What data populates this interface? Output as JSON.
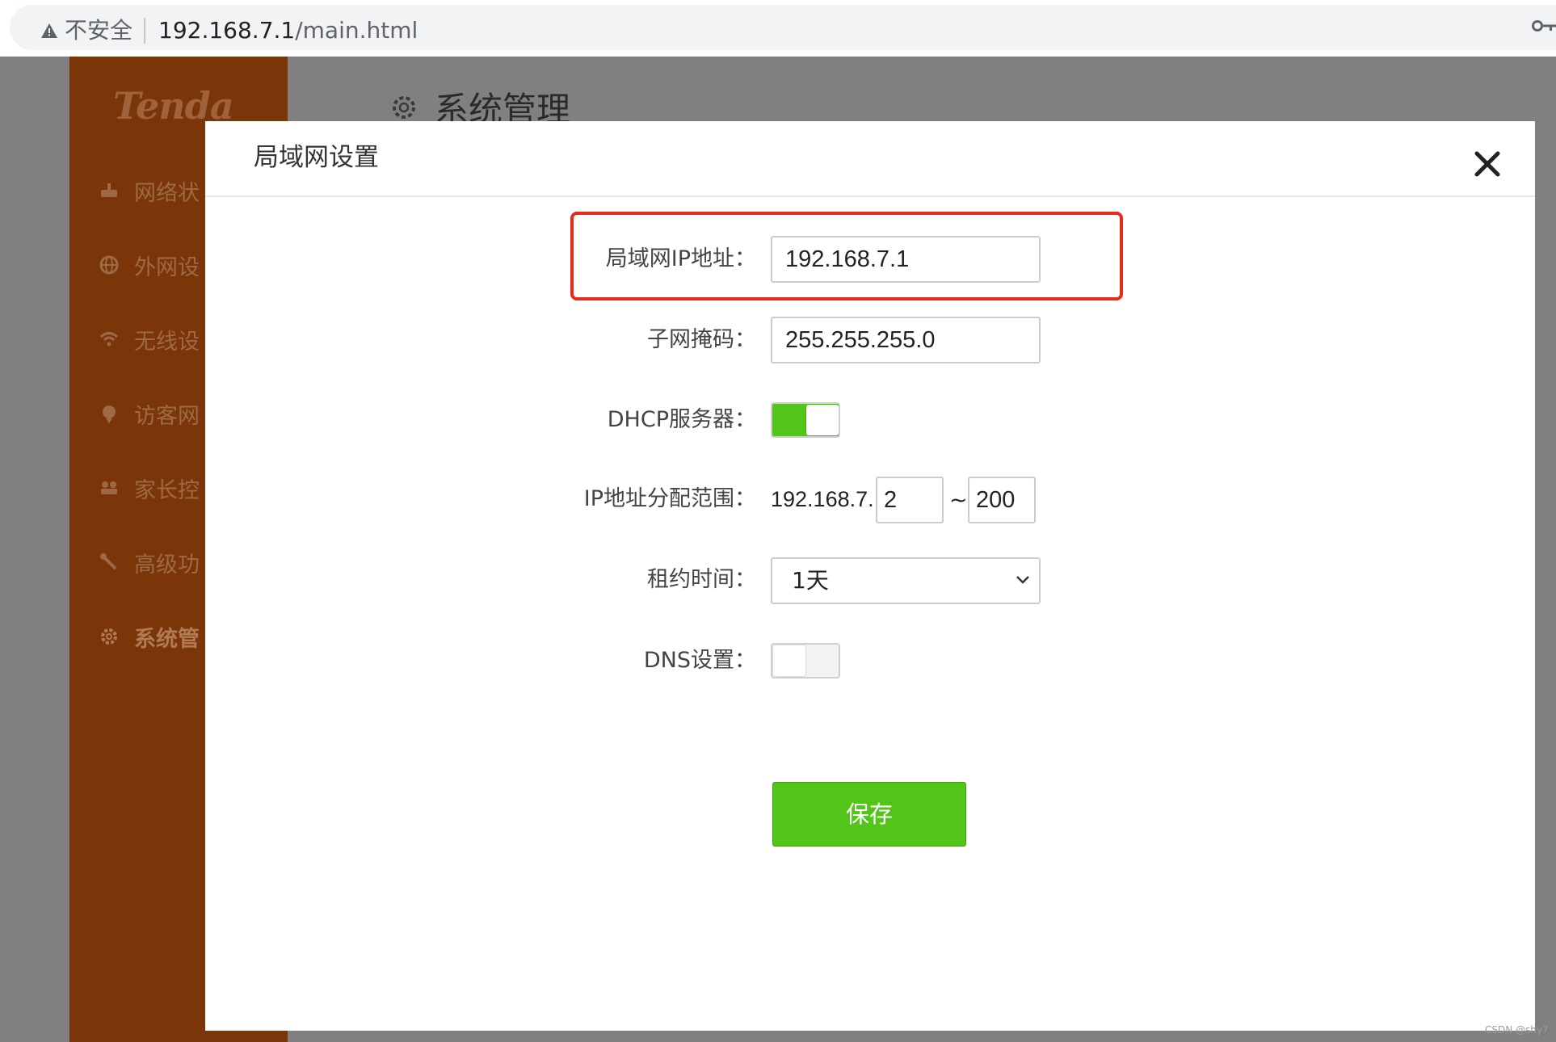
{
  "browser": {
    "security_label": "不安全",
    "url_host": "192.168.7.1",
    "url_path": "/main.html"
  },
  "app": {
    "logo": "Tenda",
    "page_title": "系统管理",
    "sidebar": {
      "items": [
        {
          "label": "网络状",
          "icon": "network-status-icon"
        },
        {
          "label": "外网设",
          "icon": "globe-icon"
        },
        {
          "label": "无线设",
          "icon": "wifi-icon"
        },
        {
          "label": "访客网",
          "icon": "guest-icon"
        },
        {
          "label": "家长控",
          "icon": "parental-icon"
        },
        {
          "label": "高级功",
          "icon": "wrench-icon"
        },
        {
          "label": "系统管",
          "icon": "gear-icon",
          "active": true
        }
      ]
    }
  },
  "modal": {
    "title": "局域网设置",
    "fields": {
      "lan_ip": {
        "label": "局域网IP地址：",
        "value": "192.168.7.1"
      },
      "subnet_mask": {
        "label": "子网掩码：",
        "value": "255.255.255.0"
      },
      "dhcp_server": {
        "label": "DHCP服务器：",
        "enabled": true
      },
      "ip_range": {
        "label": "IP地址分配范围：",
        "prefix": "192.168.7.",
        "start": "2",
        "separator": "~",
        "end": "200"
      },
      "lease_time": {
        "label": "租约时间：",
        "value": "1天"
      },
      "dns": {
        "label": "DNS设置：",
        "enabled": false
      }
    },
    "save_label": "保存"
  },
  "colors": {
    "accent_green": "#52c41a",
    "highlight_red": "#e8291c",
    "sidebar_brown": "#7a3508"
  },
  "watermark": "CSDN @shy7"
}
